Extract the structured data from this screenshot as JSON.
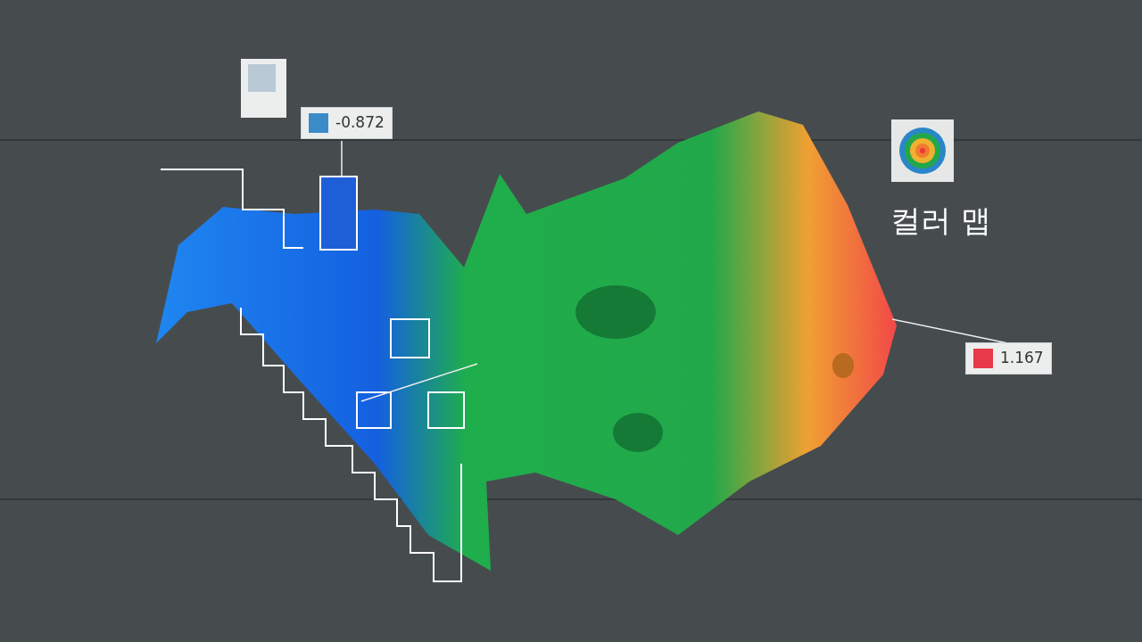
{
  "title": "컬러 맵",
  "callouts": [
    {
      "value": "-0.872",
      "color": "#3a8cc8"
    },
    {
      "value": "1.167",
      "color": "#e8394a"
    }
  ]
}
